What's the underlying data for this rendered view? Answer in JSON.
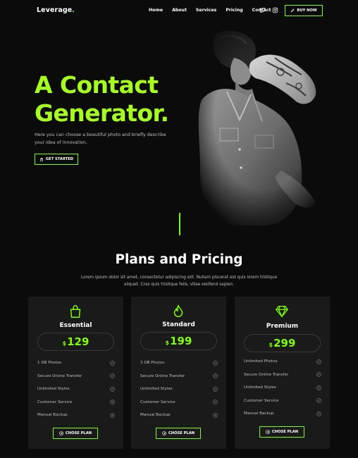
{
  "logo": {
    "text": "Leverage",
    "dot": "."
  },
  "nav": {
    "items": [
      "Home",
      "About",
      "Services",
      "Pricing",
      "Contact"
    ],
    "social_icons": [
      "twitter-icon",
      "instagram-icon"
    ],
    "buy_label": "BUY NOW"
  },
  "hero": {
    "title_line1": "A Contact",
    "title_line2": "Generator.",
    "description": "Here you can choose a beautiful photo and briefly describe your idea of innovation.",
    "cta_label": "GET STARTED"
  },
  "pricing": {
    "title": "Plans and Pricing",
    "description": "Lorem ipsum dolor sit amet, consectetur adipiscing elit. Nullam plscerat est quis lorem tristique aliquet. Cras quis tristique felis, vitae eleifend sapien.",
    "plans": [
      {
        "name": "Essential",
        "icon": "shopping-bag-icon",
        "currency": "$",
        "price": "129",
        "features": [
          "1 GB Photos",
          "Secure Online Transfer",
          "Unlimited Styles",
          "Customer Service",
          "Manual Backup"
        ],
        "button_label": "CHOSE PLAN"
      },
      {
        "name": "Standard",
        "icon": "flame-icon",
        "currency": "$",
        "price": "199",
        "features": [
          "3 GB Photos",
          "Secure Online Transfer",
          "Unlimited Styles",
          "Customer Service",
          "Manual Backup"
        ],
        "button_label": "CHOSE PLAN"
      },
      {
        "name": "Premium",
        "icon": "diamond-icon",
        "currency": "$",
        "price": "299",
        "features": [
          "Unlimited Photos",
          "Secure Online Transfer",
          "Unlimited Styles",
          "Customer Service",
          "Manual Backup"
        ],
        "button_label": "CHOSE PLAN"
      }
    ]
  },
  "colors": {
    "accent": "#7fff00",
    "hero_title": "#a6ff1f",
    "background": "#0b0b0b",
    "card": "#1a1a1a"
  }
}
